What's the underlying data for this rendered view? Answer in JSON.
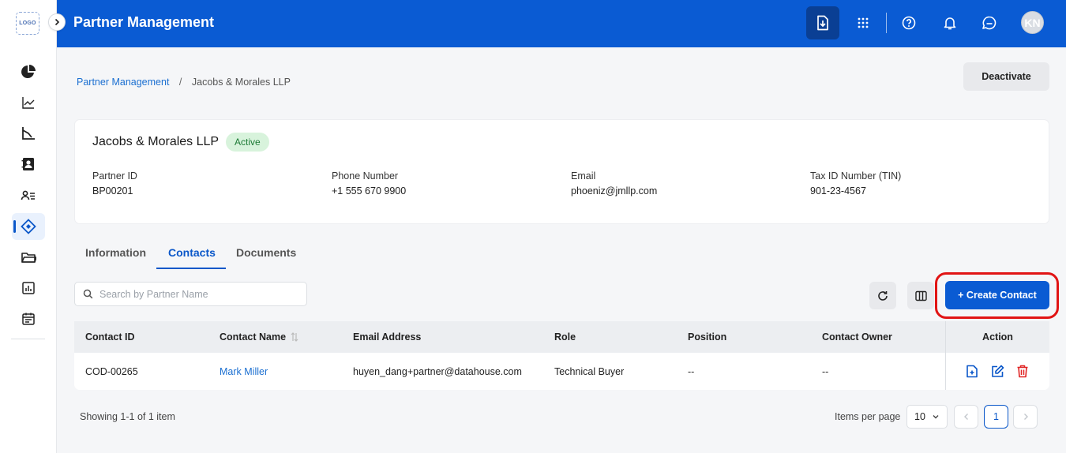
{
  "app": {
    "logo_text": "LOGO",
    "title": "Partner Management",
    "user_initials": "KN"
  },
  "sidebar": {
    "items": [
      {
        "icon": "pie-chart-icon"
      },
      {
        "icon": "line-chart-icon"
      },
      {
        "icon": "trend-chart-icon"
      },
      {
        "icon": "contact-card-icon"
      },
      {
        "icon": "user-list-icon"
      },
      {
        "icon": "partner-tag-icon",
        "active": true
      },
      {
        "icon": "folder-icon"
      },
      {
        "icon": "report-icon"
      },
      {
        "icon": "calendar-icon"
      }
    ]
  },
  "breadcrumb": {
    "root": "Partner Management",
    "separator": "/",
    "current": "Jacobs & Morales LLP"
  },
  "actions": {
    "deactivate_label": "Deactivate"
  },
  "partner": {
    "name": "Jacobs & Morales LLP",
    "status": "Active",
    "fields": [
      {
        "label": "Partner ID",
        "value": "BP00201"
      },
      {
        "label": "Phone Number",
        "value": "+1 555 670 9900"
      },
      {
        "label": "Email",
        "value": "phoeniz@jmllp.com"
      },
      {
        "label": "Tax ID Number (TIN)",
        "value": "901-23-4567"
      }
    ]
  },
  "tabs": [
    {
      "label": "Information"
    },
    {
      "label": "Contacts",
      "active": true
    },
    {
      "label": "Documents"
    }
  ],
  "toolbar": {
    "search_placeholder": "Search by Partner Name",
    "create_label": "+ Create Contact"
  },
  "table": {
    "columns": [
      "Contact ID",
      "Contact Name",
      "Email Address",
      "Role",
      "Position",
      "Contact Owner",
      "Action"
    ],
    "rows": [
      {
        "contact_id": "COD-00265",
        "contact_name": "Mark Miller",
        "email": "huyen_dang+partner@datahouse.com",
        "role": "Technical Buyer",
        "position": "--",
        "owner": "--"
      }
    ]
  },
  "footer": {
    "showing": "Showing 1-1 of 1 item",
    "items_per_page_label": "Items per page",
    "items_per_page": "10",
    "current_page": "1"
  },
  "colors": {
    "primary": "#0a5bd3",
    "highlight": "#e11414",
    "delete": "#e02424",
    "status_bg": "#d8f3dc"
  }
}
